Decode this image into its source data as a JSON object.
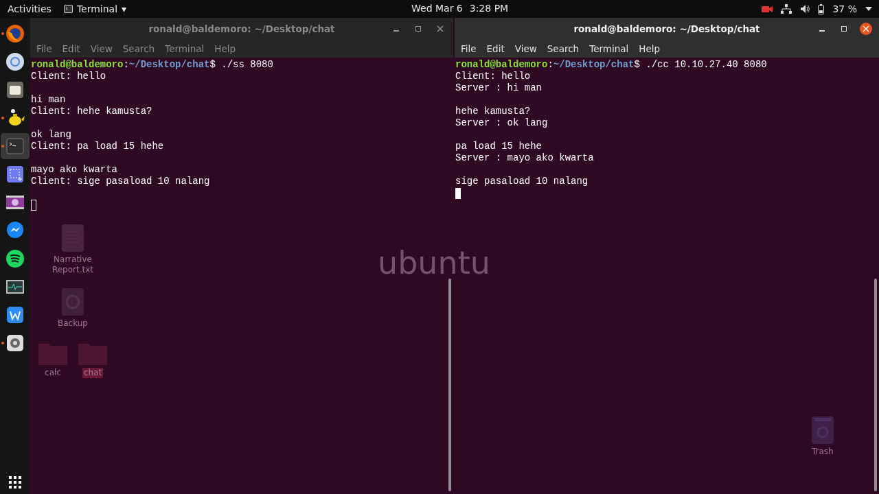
{
  "top_bar": {
    "activities": "Activities",
    "app_menu": "Terminal",
    "app_menu_caret": "▾",
    "date": "Wed Mar 6",
    "time": "3:28 PM",
    "battery": "37 %"
  },
  "dock": {
    "items": [
      {
        "kind": "fox",
        "running": true,
        "selected": false
      },
      {
        "kind": "chrome",
        "running": false,
        "selected": false
      },
      {
        "kind": "files",
        "running": false,
        "selected": false
      },
      {
        "kind": "teapot",
        "running": true,
        "selected": false
      },
      {
        "kind": "terminal",
        "running": true,
        "selected": true
      },
      {
        "kind": "screenshot",
        "running": false,
        "selected": false
      },
      {
        "kind": "video",
        "running": false,
        "selected": false
      },
      {
        "kind": "messenger",
        "running": false,
        "selected": false
      },
      {
        "kind": "music",
        "running": false,
        "selected": false
      },
      {
        "kind": "monitor",
        "running": false,
        "selected": false
      },
      {
        "kind": "writer",
        "running": false,
        "selected": false
      },
      {
        "kind": "settings",
        "running": true,
        "selected": false
      }
    ]
  },
  "desktop": {
    "wallpaper_logo": "ubuntu",
    "icons": [
      {
        "kind": "document",
        "label": "Narrative Report.txt",
        "selected": false
      },
      {
        "kind": "backup",
        "label": "Backup",
        "selected": false
      },
      {
        "kind": "folder",
        "label": "calc",
        "selected": false
      },
      {
        "kind": "folder",
        "label": "chat",
        "selected": true
      }
    ],
    "trash": {
      "label": "Trash"
    }
  },
  "windows": [
    {
      "title": "ronald@baldemoro: ~/Desktop/chat",
      "active": false,
      "menu": [
        "File",
        "Edit",
        "View",
        "Search",
        "Terminal",
        "Help"
      ],
      "lines": [
        {
          "kind": "prompt",
          "user": "ronald@baldemoro",
          "colon": ":",
          "path": "~/Desktop/chat",
          "command": "$ ./ss 8080"
        },
        {
          "kind": "text",
          "text": "Client: hello"
        },
        {
          "kind": "blank"
        },
        {
          "kind": "text",
          "text": "hi man"
        },
        {
          "kind": "text",
          "text": "Client: hehe kamusta?"
        },
        {
          "kind": "blank"
        },
        {
          "kind": "text",
          "text": "ok lang"
        },
        {
          "kind": "text",
          "text": "Client: pa load 15 hehe"
        },
        {
          "kind": "blank"
        },
        {
          "kind": "text",
          "text": "mayo ako kwarta"
        },
        {
          "kind": "text",
          "text": "Client: sige pasaload 10 nalang"
        },
        {
          "kind": "blank"
        },
        {
          "kind": "cursor"
        }
      ]
    },
    {
      "title": "ronald@baldemoro: ~/Desktop/chat",
      "active": true,
      "menu": [
        "File",
        "Edit",
        "View",
        "Search",
        "Terminal",
        "Help"
      ],
      "lines": [
        {
          "kind": "prompt",
          "user": "ronald@baldemoro",
          "colon": ":",
          "path": "~/Desktop/chat",
          "command": "$ ./cc 10.10.27.40 8080"
        },
        {
          "kind": "text",
          "text": "Client: hello"
        },
        {
          "kind": "text",
          "text": "Server : hi man"
        },
        {
          "kind": "blank"
        },
        {
          "kind": "text",
          "text": "hehe kamusta?"
        },
        {
          "kind": "text",
          "text": "Server : ok lang"
        },
        {
          "kind": "blank"
        },
        {
          "kind": "text",
          "text": "pa load 15 hehe"
        },
        {
          "kind": "text",
          "text": "Server : mayo ako kwarta"
        },
        {
          "kind": "blank"
        },
        {
          "kind": "text",
          "text": "sige pasaload 10 nalang"
        },
        {
          "kind": "cursor"
        }
      ]
    }
  ]
}
